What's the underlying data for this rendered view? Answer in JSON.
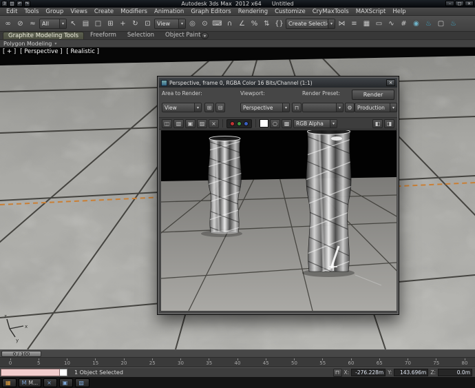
{
  "colors": {
    "accent_orange": "#c97f35",
    "viewport_marble": "#aeaeaa",
    "listener_pink": "#f2cdcd",
    "channel_red": "#c03434",
    "channel_green": "#3f9b3f",
    "channel_blue": "#3a5fc0",
    "render_teal": "#3fa9c9"
  },
  "window": {
    "title": "Autodesk 3ds Max  2012 x64      Untitled",
    "minimize": "–",
    "maximize": "□",
    "close": "×"
  },
  "qat_icons": [
    {
      "name": "max-logo-icon",
      "glyph": "3"
    },
    {
      "name": "save-file-icon",
      "glyph": "◫"
    },
    {
      "name": "undo-icon",
      "glyph": "↶"
    },
    {
      "name": "redo-icon",
      "glyph": "↷"
    }
  ],
  "menubar": {
    "items": [
      "Edit",
      "Tools",
      "Group",
      "Views",
      "Create",
      "Modifiers",
      "Animation",
      "Graph Editors",
      "Rendering",
      "Customize",
      "CryMaxTools",
      "MAXScript",
      "Help"
    ]
  },
  "toolbar": {
    "icons_a": [
      {
        "name": "select-and-link-icon",
        "glyph": "∞"
      },
      {
        "name": "unlink-selection-icon",
        "glyph": "⊘"
      },
      {
        "name": "bind-to-space-warp-icon",
        "glyph": "≈"
      }
    ],
    "filter_value": "All",
    "icons_b": [
      {
        "name": "select-object-icon",
        "glyph": "↖"
      },
      {
        "name": "select-by-name-icon",
        "glyph": "▤"
      },
      {
        "name": "rectangular-selection-region-icon",
        "glyph": "□"
      },
      {
        "name": "window-crossing-icon",
        "glyph": "⊞"
      },
      {
        "name": "select-and-move-icon",
        "glyph": "+"
      },
      {
        "name": "select-and-rotate-icon",
        "glyph": "↻"
      },
      {
        "name": "select-and-scale-icon",
        "glyph": "⊡"
      }
    ],
    "coord_value": "View",
    "icons_c": [
      {
        "name": "use-pivot-center-icon",
        "glyph": "◎"
      },
      {
        "name": "select-and-manipulate-icon",
        "glyph": "⊙"
      },
      {
        "name": "keyboard-shortcut-override-icon",
        "glyph": "⌨"
      },
      {
        "name": "snaps-toggle-icon",
        "glyph": "∩"
      },
      {
        "name": "angle-snap-icon",
        "glyph": "∠"
      },
      {
        "name": "percent-snap-icon",
        "glyph": "%"
      },
      {
        "name": "spinner-snap-icon",
        "glyph": "⇅"
      },
      {
        "name": "edit-named-selection-sets-icon",
        "glyph": "{}"
      }
    ],
    "named_value": "Create Selection S",
    "icons_d": [
      {
        "name": "mirror-icon",
        "glyph": "⋈"
      },
      {
        "name": "align-icon",
        "glyph": "≡"
      },
      {
        "name": "layer-manager-icon",
        "glyph": "▦"
      },
      {
        "name": "graphite-ribbon-toggle-icon",
        "glyph": "▭"
      },
      {
        "name": "curve-editor-icon",
        "glyph": "∿"
      },
      {
        "name": "schematic-view-icon",
        "glyph": "#"
      },
      {
        "name": "material-editor-icon",
        "glyph": "◉"
      },
      {
        "name": "render-setup-icon",
        "glyph": "♨"
      },
      {
        "name": "rendered-frame-window-icon",
        "glyph": "▢"
      },
      {
        "name": "render-production-icon",
        "glyph": "♨"
      }
    ]
  },
  "ribbon": {
    "tabs": [
      {
        "label": "Graphite Modeling Tools",
        "selected": "true"
      },
      {
        "label": "Freeform",
        "selected": "false"
      },
      {
        "label": "Selection",
        "selected": "false"
      },
      {
        "label": "Object Paint",
        "selected": "false"
      }
    ],
    "collapse_glyph": "▾",
    "subtab": "Polygon Modeling",
    "subtab_arrow": "▾"
  },
  "viewport": {
    "label_general": "[ + ]",
    "label_view": "[ Perspective ]",
    "label_shading": "[ Realistic ]"
  },
  "render_window": {
    "title": "Perspective, frame 0, RGBA Color 16 Bits/Channel (1:1)",
    "close": "×",
    "area_label": "Area to Render:",
    "area_value": "View",
    "viewport_label": "Viewport:",
    "viewport_value": "Perspective",
    "preset_label": "Render Preset:",
    "preset_value": "",
    "render_button": "Render",
    "production_value": "Production",
    "channel_value": "RGB Alpha",
    "left_icons": [
      {
        "name": "save-image-icon",
        "glyph": "◫"
      },
      {
        "name": "copy-image-icon",
        "glyph": "▥"
      },
      {
        "name": "clone-window-icon",
        "glyph": "▣"
      },
      {
        "name": "print-image-icon",
        "glyph": "▨"
      },
      {
        "name": "clear-image-icon",
        "glyph": "×"
      }
    ],
    "channels": [
      {
        "name": "red-channel-button",
        "cls": "dot red"
      },
      {
        "name": "green-channel-button",
        "cls": "dot green"
      },
      {
        "name": "blue-channel-button",
        "cls": "dot blue"
      }
    ],
    "mono_icons": [
      {
        "name": "monochrome-icon",
        "glyph": "○"
      },
      {
        "name": "alpha-channel-icon",
        "glyph": "▩"
      }
    ],
    "right_icons": [
      {
        "name": "color-correction-icon",
        "glyph": "◧"
      },
      {
        "name": "display-mode-icon",
        "glyph": "◨"
      }
    ]
  },
  "timeline": {
    "slider_label": "0 / 100",
    "ticks": [
      "0",
      "5",
      "10",
      "15",
      "20",
      "25",
      "30",
      "35",
      "40",
      "45",
      "50",
      "55",
      "60",
      "65",
      "70",
      "75",
      "80"
    ]
  },
  "statusbar": {
    "selection_text": "1 Object Selected",
    "x_label": "X:",
    "x_value": "-276.228m",
    "y_label": "Y:",
    "y_value": "143.696m",
    "z_label": "Z:",
    "z_value": "0.0m"
  },
  "taskbar": {
    "items": [
      {
        "name": "taskbar-start-button",
        "glyph": "▦",
        "label": ""
      },
      {
        "name": "taskbar-3dsmax-button",
        "glyph": "M",
        "label": "M..."
      },
      {
        "name": "taskbar-close-button",
        "glyph": "×",
        "label": ""
      },
      {
        "name": "taskbar-window-button",
        "glyph": "▣",
        "label": ""
      },
      {
        "name": "taskbar-window-button-2",
        "glyph": "▧",
        "label": ""
      }
    ]
  }
}
